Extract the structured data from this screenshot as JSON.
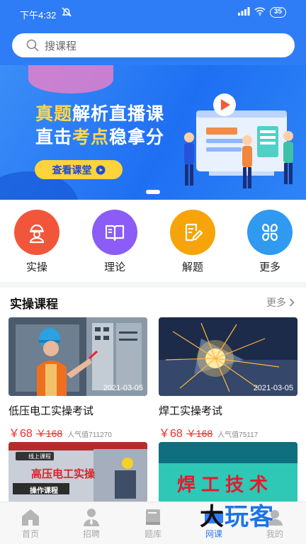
{
  "status_bar": {
    "time": "下午4:32",
    "battery": "35"
  },
  "search": {
    "placeholder": "搜课程"
  },
  "banner": {
    "line1_a": "真题",
    "line1_b": "解析直播课",
    "line2_a": "直击",
    "line2_b": "考点",
    "line2_c": "稳拿分",
    "cta": "查看课堂"
  },
  "categories": [
    {
      "label": "实操",
      "icon": "worker-icon",
      "color": "#f2563a"
    },
    {
      "label": "理论",
      "icon": "book-icon",
      "color": "#8b5cf6"
    },
    {
      "label": "解题",
      "icon": "edit-doc-icon",
      "color": "#f6a40a"
    },
    {
      "label": "更多",
      "icon": "grid-icon",
      "color": "#2f9af0"
    }
  ],
  "section": {
    "title": "实操课程",
    "more": "更多"
  },
  "courses": [
    {
      "title": "低压电工实操考试",
      "date": "2021-03-05",
      "price": "￥68",
      "old_price": "￥168",
      "popularity": "人气值711270"
    },
    {
      "title": "焊工实操考试",
      "date": "2021-03-05",
      "price": "￥68",
      "old_price": "￥168",
      "popularity": "人气值75117"
    }
  ],
  "row2": {
    "left_badge": "线上课程",
    "left_title": "高压电工实操",
    "left_sub": "操作课程",
    "right_title": "焊工技术"
  },
  "tabs": [
    {
      "label": "首页",
      "icon": "home-icon"
    },
    {
      "label": "招聘",
      "icon": "person-icon"
    },
    {
      "label": "题库",
      "icon": "book-icon"
    },
    {
      "label": "网课",
      "icon": "video-icon",
      "active": true
    },
    {
      "label": "我的",
      "icon": "user-icon"
    }
  ],
  "watermark": {
    "a": "大",
    "b": "玩客"
  }
}
